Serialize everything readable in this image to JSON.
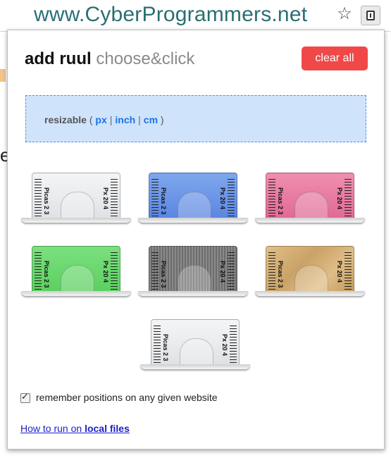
{
  "browser": {
    "url": "www.CyberProgrammers.net",
    "star_icon": "star-icon",
    "extension_icon": "ruler-extension-icon"
  },
  "popup": {
    "title_bold": "add ruul",
    "title_light": "choose&click",
    "clear_button": "clear all",
    "resize": {
      "label": "resizable",
      "open_paren": "(",
      "close_paren": ")",
      "units": [
        "px",
        "inch",
        "cm"
      ]
    },
    "rulers": [
      {
        "name": "white",
        "color": "#e6e8ea",
        "left_label": "Picas 2 3",
        "right_label": "Px 20 4"
      },
      {
        "name": "blue",
        "color": "#6d95e6",
        "left_label": "Picas 2 3",
        "right_label": "Px 20 4"
      },
      {
        "name": "pink",
        "color": "#e67ca0",
        "left_label": "Picas 2 3",
        "right_label": "Px 20 4"
      },
      {
        "name": "green",
        "color": "#6ed96f",
        "left_label": "Picas 2 3",
        "right_label": "Px 20 4"
      },
      {
        "name": "gray",
        "color": "#7b7b7b",
        "left_label": "Picas 2 3",
        "right_label": "Px 20 4"
      },
      {
        "name": "wood",
        "color": "#d3ad74",
        "left_label": "Picas 2 3",
        "right_label": "Px 20 4"
      },
      {
        "name": "white-2",
        "color": "#e6e8ea",
        "left_label": "Picas 2 3",
        "right_label": "Px 20 4"
      }
    ],
    "remember_label": "remember positions on any given website",
    "remember_checked": true,
    "howto_prefix": "How to run on ",
    "howto_bold": "local files"
  }
}
